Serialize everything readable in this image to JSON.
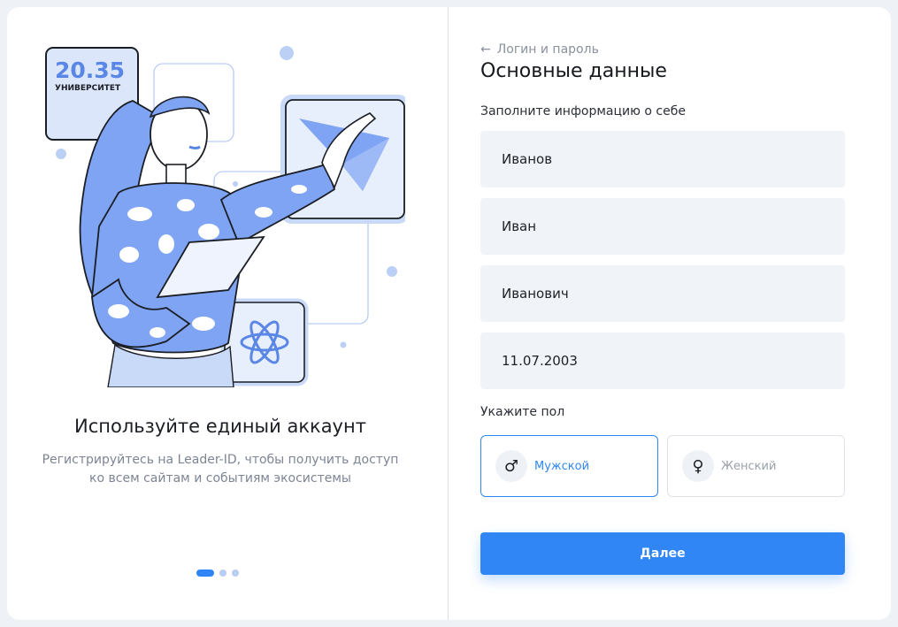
{
  "promo": {
    "logo_number": "20.35",
    "logo_caption": "УНИВЕРСИТЕТ",
    "title": "Используйте единый аккаунт",
    "text_line1": "Регистрируйтесь на Leader-ID, чтобы получить доступ",
    "text_line2": "ко всем сайтам и событиям экосистемы",
    "slides": {
      "count": 3,
      "active": 1
    }
  },
  "form": {
    "back_label": "Логин и пароль",
    "back_icon": "arrow-left-icon",
    "title": "Основные данные",
    "subtitle": "Заполните информацию о себе",
    "last_name": "Иванов",
    "first_name": "Иван",
    "middle_name": "Иванович",
    "birth_date": "11.07.2003",
    "gender_label": "Укажите пол",
    "gender_male": "Мужской",
    "gender_female": "Женский",
    "gender_selected": "male",
    "male_icon": "♂",
    "female_icon": "♀",
    "next_label": "Далее"
  },
  "colors": {
    "accent": "#2f86f4",
    "field_bg": "#f0f3f7",
    "illustration_blue": "#7ea4f3"
  }
}
